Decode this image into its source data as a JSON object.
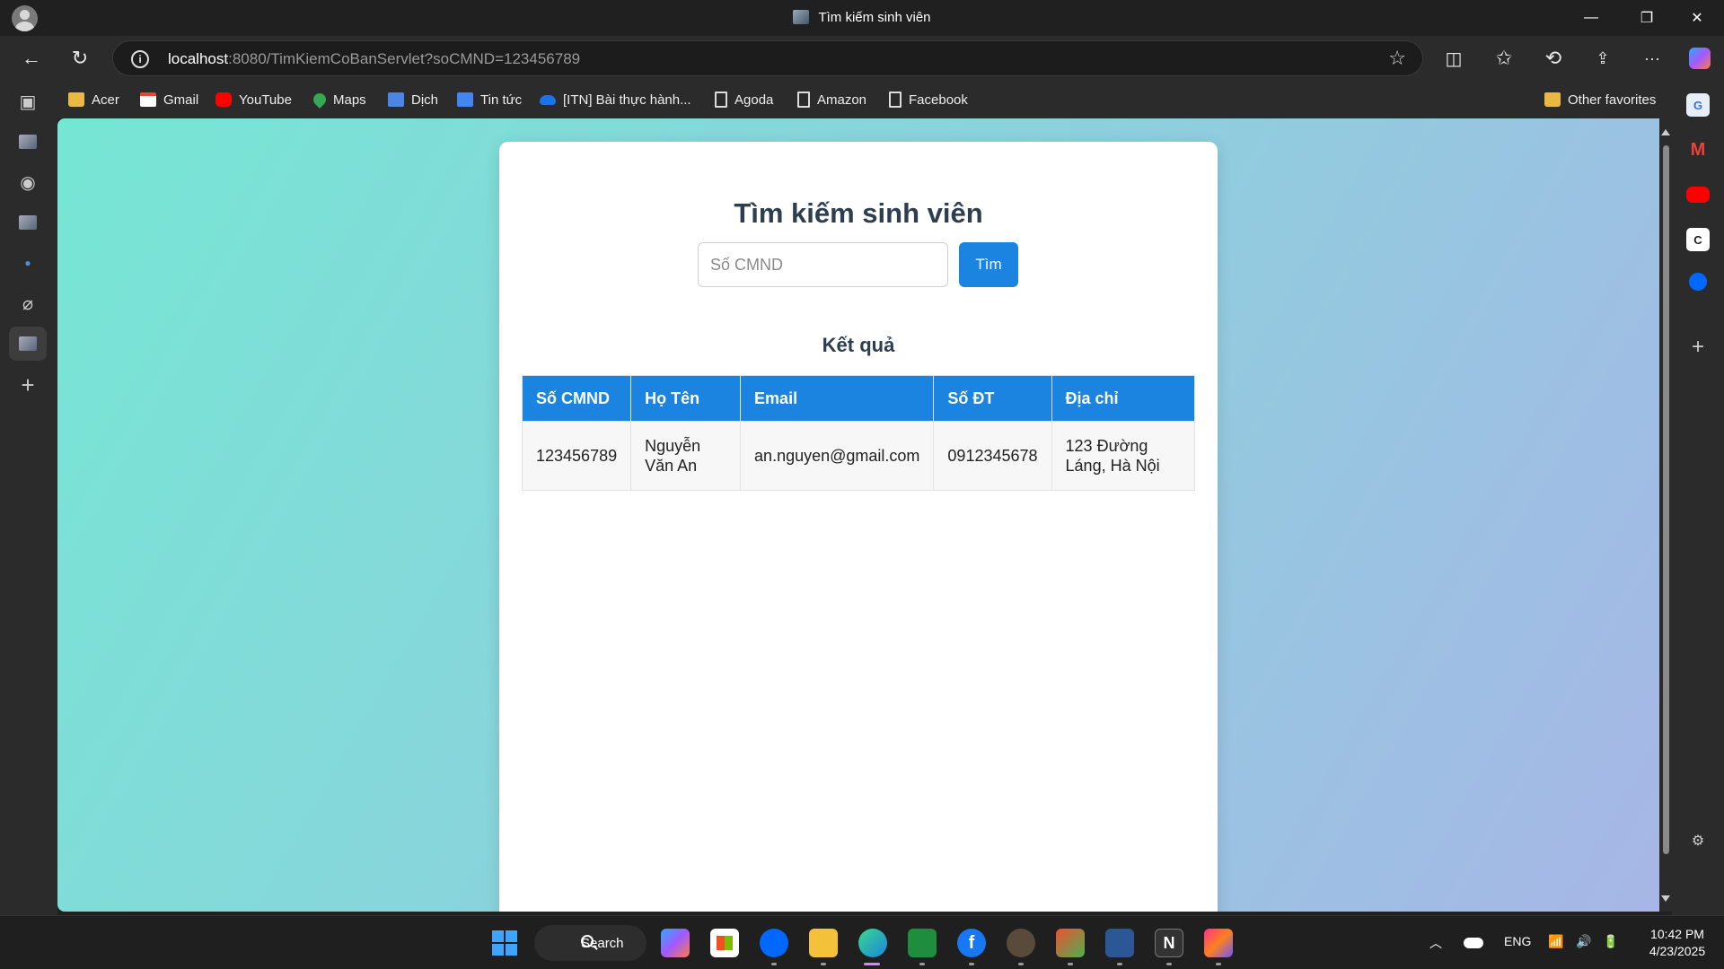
{
  "window": {
    "title": "Tìm kiếm sinh viên",
    "minimize_glyph": "—",
    "restore_glyph": "❐",
    "close_glyph": "✕"
  },
  "address_bar": {
    "url_host": "localhost",
    "url_rest": ":8080/TimKiemCoBanServlet?soCMND=123456789",
    "info_glyph": "i",
    "star_glyph": "☆"
  },
  "nav": {
    "back_glyph": "←",
    "refresh_glyph": "↻",
    "split_glyph": "◫",
    "favorites_glyph": "✩",
    "history_glyph": "⟲",
    "share_glyph": "⇪",
    "more_glyph": "···"
  },
  "bookmarks": [
    {
      "label": "Acer",
      "icon": "folder-icon"
    },
    {
      "label": "Gmail",
      "icon": "gmail-icon"
    },
    {
      "label": "YouTube",
      "icon": "youtube-icon"
    },
    {
      "label": "Maps",
      "icon": "maps-icon"
    },
    {
      "label": "Dịch",
      "icon": "translate-icon"
    },
    {
      "label": "Tin tức",
      "icon": "news-icon"
    },
    {
      "label": "[ITN] Bài thực hành...",
      "icon": "cloud-icon"
    },
    {
      "label": "Agoda",
      "icon": "page-icon"
    },
    {
      "label": "Amazon",
      "icon": "page-icon"
    },
    {
      "label": "Facebook",
      "icon": "page-icon"
    }
  ],
  "other_favorites": "Other favorites",
  "page": {
    "heading": "Tìm kiếm sinh viên",
    "search_placeholder": "Số CMND",
    "search_button": "Tìm",
    "results_heading": "Kết quả",
    "table": {
      "headers": [
        "Số CMND",
        "Họ Tên",
        "Email",
        "Số ĐT",
        "Địa chỉ"
      ],
      "rows": [
        [
          "123456789",
          "Nguyễn Văn An",
          "an.nguyen@gmail.com",
          "0912345678",
          "123 Đường Láng, Hà Nội"
        ]
      ]
    }
  },
  "taskbar": {
    "search_label": "Search",
    "lang": "ENG",
    "time": "10:42 PM",
    "date": "4/23/2025"
  },
  "colors": {
    "accent": "#1a84e0",
    "heading": "#2c3e50",
    "gradient_start": "#76e6d4",
    "gradient_end": "#a7b6e6"
  }
}
